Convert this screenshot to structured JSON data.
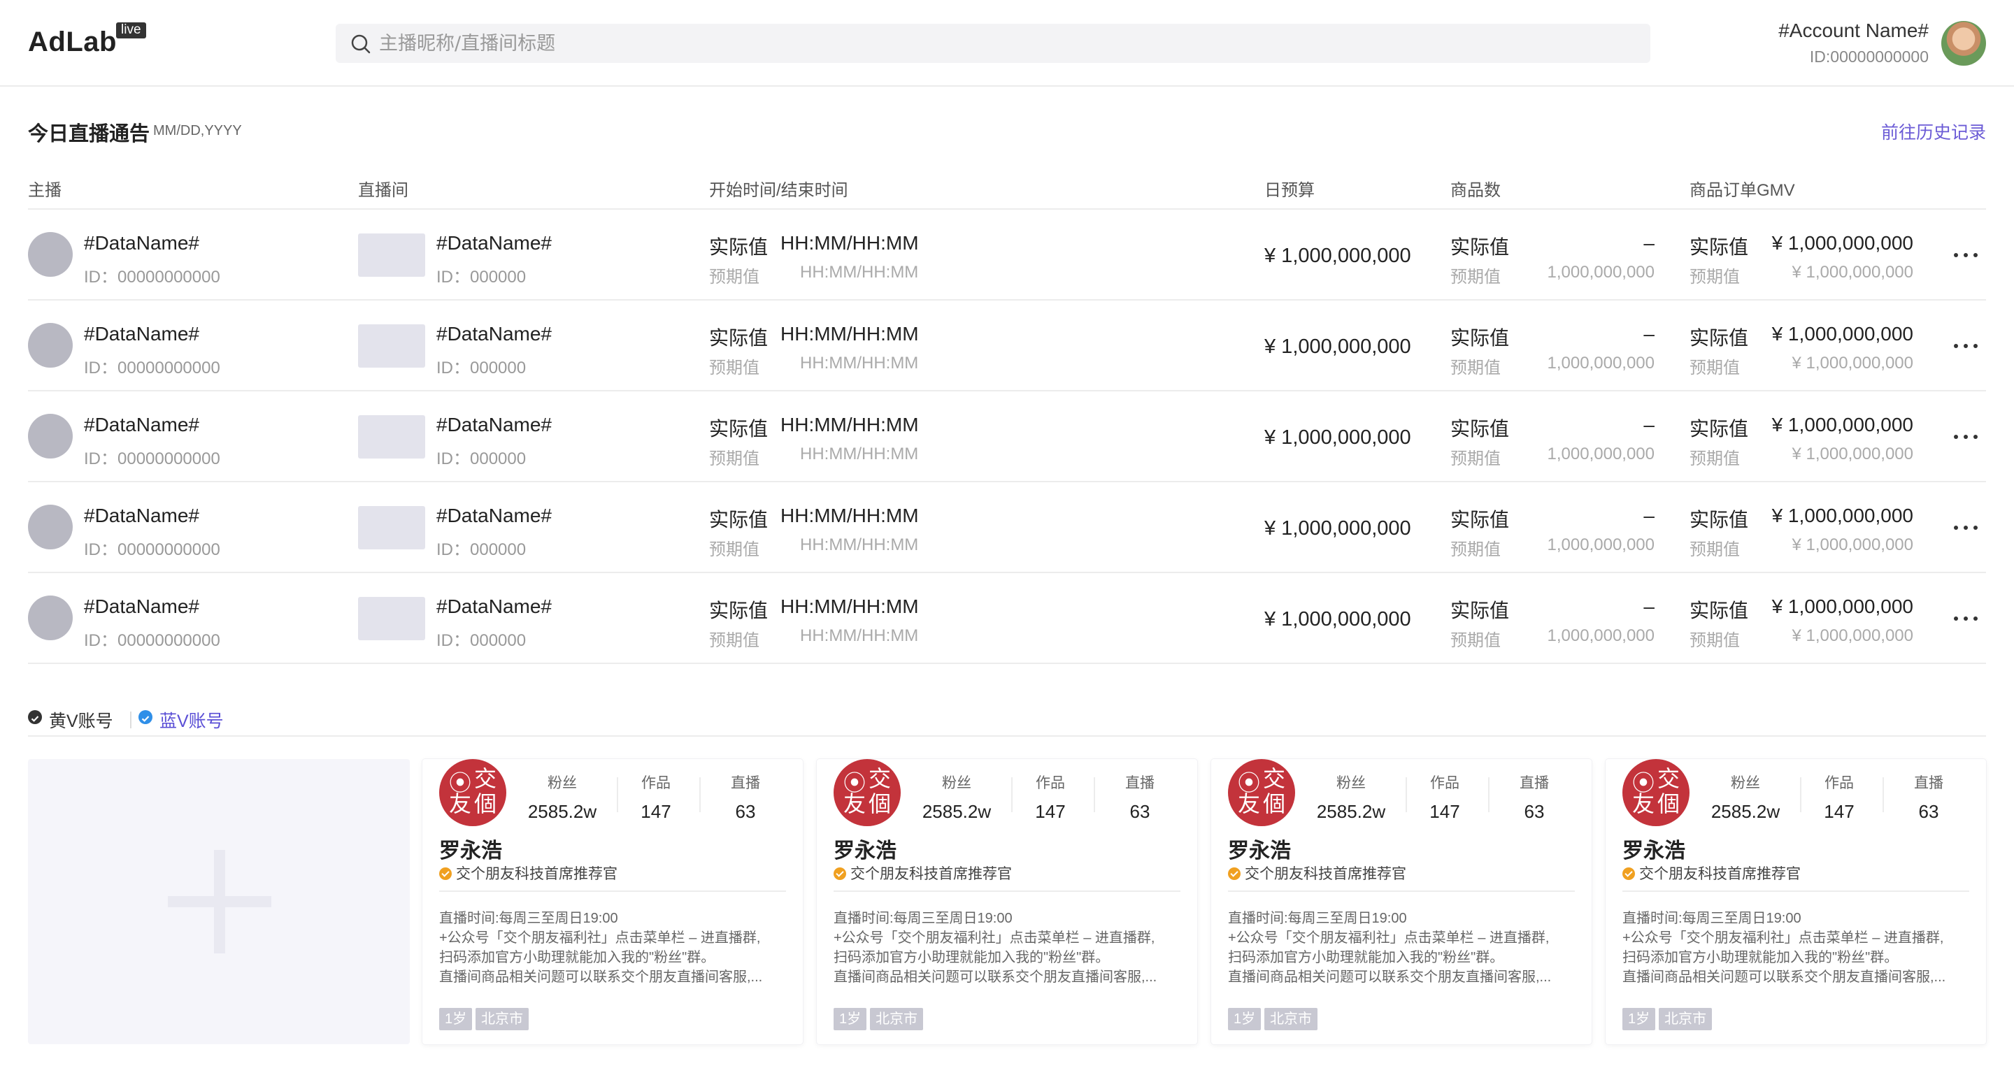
{
  "header": {
    "logo": "AdLab",
    "logo_badge": "live",
    "search_placeholder": "主播昵称/直播间标题",
    "account_name": "#Account Name#",
    "account_id": "ID:00000000000"
  },
  "section": {
    "title": "今日直播通告",
    "date": "MM/DD,YYYY",
    "history_link": "前往历史记录"
  },
  "table": {
    "columns": [
      "主播",
      "直播间",
      "开始时间/结束时间",
      "日预算",
      "商品数",
      "商品订单GMV"
    ],
    "rows": [
      {
        "host_name": "#DataName#",
        "host_id": "ID：00000000000",
        "room_name": "#DataName#",
        "room_id": "ID：000000",
        "time_actual_label": "实际值",
        "time_actual": "HH:MM/HH:MM",
        "time_expected_label": "预期值",
        "time_expected": "HH:MM/HH:MM",
        "budget": "¥ 1,000,000,000",
        "goods_actual_label": "实际值",
        "goods_actual": "–",
        "goods_expected_label": "预期值",
        "goods_expected": "1,000,000,000",
        "gmv_actual_label": "实际值",
        "gmv_actual": "¥ 1,000,000,000",
        "gmv_expected_label": "预期值",
        "gmv_expected": "¥ 1,000,000,000"
      },
      {
        "host_name": "#DataName#",
        "host_id": "ID：00000000000",
        "room_name": "#DataName#",
        "room_id": "ID：000000",
        "time_actual_label": "实际值",
        "time_actual": "HH:MM/HH:MM",
        "time_expected_label": "预期值",
        "time_expected": "HH:MM/HH:MM",
        "budget": "¥ 1,000,000,000",
        "goods_actual_label": "实际值",
        "goods_actual": "–",
        "goods_expected_label": "预期值",
        "goods_expected": "1,000,000,000",
        "gmv_actual_label": "实际值",
        "gmv_actual": "¥ 1,000,000,000",
        "gmv_expected_label": "预期值",
        "gmv_expected": "¥ 1,000,000,000"
      },
      {
        "host_name": "#DataName#",
        "host_id": "ID：00000000000",
        "room_name": "#DataName#",
        "room_id": "ID：000000",
        "time_actual_label": "实际值",
        "time_actual": "HH:MM/HH:MM",
        "time_expected_label": "预期值",
        "time_expected": "HH:MM/HH:MM",
        "budget": "¥ 1,000,000,000",
        "goods_actual_label": "实际值",
        "goods_actual": "–",
        "goods_expected_label": "预期值",
        "goods_expected": "1,000,000,000",
        "gmv_actual_label": "实际值",
        "gmv_actual": "¥ 1,000,000,000",
        "gmv_expected_label": "预期值",
        "gmv_expected": "¥ 1,000,000,000"
      },
      {
        "host_name": "#DataName#",
        "host_id": "ID：00000000000",
        "room_name": "#DataName#",
        "room_id": "ID：000000",
        "time_actual_label": "实际值",
        "time_actual": "HH:MM/HH:MM",
        "time_expected_label": "预期值",
        "time_expected": "HH:MM/HH:MM",
        "budget": "¥ 1,000,000,000",
        "goods_actual_label": "实际值",
        "goods_actual": "–",
        "goods_expected_label": "预期值",
        "goods_expected": "1,000,000,000",
        "gmv_actual_label": "实际值",
        "gmv_actual": "¥ 1,000,000,000",
        "gmv_expected_label": "预期值",
        "gmv_expected": "¥ 1,000,000,000"
      },
      {
        "host_name": "#DataName#",
        "host_id": "ID：00000000000",
        "room_name": "#DataName#",
        "room_id": "ID：000000",
        "time_actual_label": "实际值",
        "time_actual": "HH:MM/HH:MM",
        "time_expected_label": "预期值",
        "time_expected": "HH:MM/HH:MM",
        "budget": "¥ 1,000,000,000",
        "goods_actual_label": "实际值",
        "goods_actual": "–",
        "goods_expected_label": "预期值",
        "goods_expected": "1,000,000,000",
        "gmv_actual_label": "实际值",
        "gmv_actual": "¥ 1,000,000,000",
        "gmv_expected_label": "预期值",
        "gmv_expected": "¥ 1,000,000,000"
      }
    ]
  },
  "tabs": [
    {
      "label": "黄V账号",
      "icon": "check-circle-icon",
      "color": "#333333",
      "active": true
    },
    {
      "label": "蓝V账号",
      "icon": "check-circle-icon",
      "color": "#2f8fe8",
      "active": false
    }
  ],
  "add_card": {
    "icon": "plus-icon"
  },
  "cards": [
    {
      "logo_text": [
        "交",
        "友",
        "個"
      ],
      "stats": [
        {
          "label": "粉丝",
          "value": "2585.2w"
        },
        {
          "label": "作品",
          "value": "147"
        },
        {
          "label": "直播",
          "value": "63"
        }
      ],
      "name": "罗永浩",
      "verify": "交个朋友科技首席推荐官",
      "desc": [
        "直播时间:每周三至周日19:00",
        "+公众号「交个朋友福利社」点击菜单栏 – 进直播群,",
        "扫码添加官方小助理就能加入我的\"粉丝\"群。",
        "直播间商品相关问题可以联系交个朋友直播间客服,..."
      ],
      "tags": [
        "1岁",
        "北京市"
      ]
    },
    {
      "logo_text": [
        "交",
        "友",
        "個"
      ],
      "stats": [
        {
          "label": "粉丝",
          "value": "2585.2w"
        },
        {
          "label": "作品",
          "value": "147"
        },
        {
          "label": "直播",
          "value": "63"
        }
      ],
      "name": "罗永浩",
      "verify": "交个朋友科技首席推荐官",
      "desc": [
        "直播时间:每周三至周日19:00",
        "+公众号「交个朋友福利社」点击菜单栏 – 进直播群,",
        "扫码添加官方小助理就能加入我的\"粉丝\"群。",
        "直播间商品相关问题可以联系交个朋友直播间客服,..."
      ],
      "tags": [
        "1岁",
        "北京市"
      ]
    },
    {
      "logo_text": [
        "交",
        "友",
        "個"
      ],
      "stats": [
        {
          "label": "粉丝",
          "value": "2585.2w"
        },
        {
          "label": "作品",
          "value": "147"
        },
        {
          "label": "直播",
          "value": "63"
        }
      ],
      "name": "罗永浩",
      "verify": "交个朋友科技首席推荐官",
      "desc": [
        "直播时间:每周三至周日19:00",
        "+公众号「交个朋友福利社」点击菜单栏 – 进直播群,",
        "扫码添加官方小助理就能加入我的\"粉丝\"群。",
        "直播间商品相关问题可以联系交个朋友直播间客服,..."
      ],
      "tags": [
        "1岁",
        "北京市"
      ]
    },
    {
      "logo_text": [
        "交",
        "友",
        "個"
      ],
      "stats": [
        {
          "label": "粉丝",
          "value": "2585.2w"
        },
        {
          "label": "作品",
          "value": "147"
        },
        {
          "label": "直播",
          "value": "63"
        }
      ],
      "name": "罗永浩",
      "verify": "交个朋友科技首席推荐官",
      "desc": [
        "直播时间:每周三至周日19:00",
        "+公众号「交个朋友福利社」点击菜单栏 – 进直播群,",
        "扫码添加官方小助理就能加入我的\"粉丝\"群。",
        "直播间商品相关问题可以联系交个朋友直播间客服,..."
      ],
      "tags": [
        "1岁",
        "北京市"
      ]
    }
  ],
  "colors": {
    "accent": "#6b5bd6",
    "brand_red": "#c3333b",
    "verify_orange": "#f0a020",
    "blue_v": "#2f8fe8"
  }
}
